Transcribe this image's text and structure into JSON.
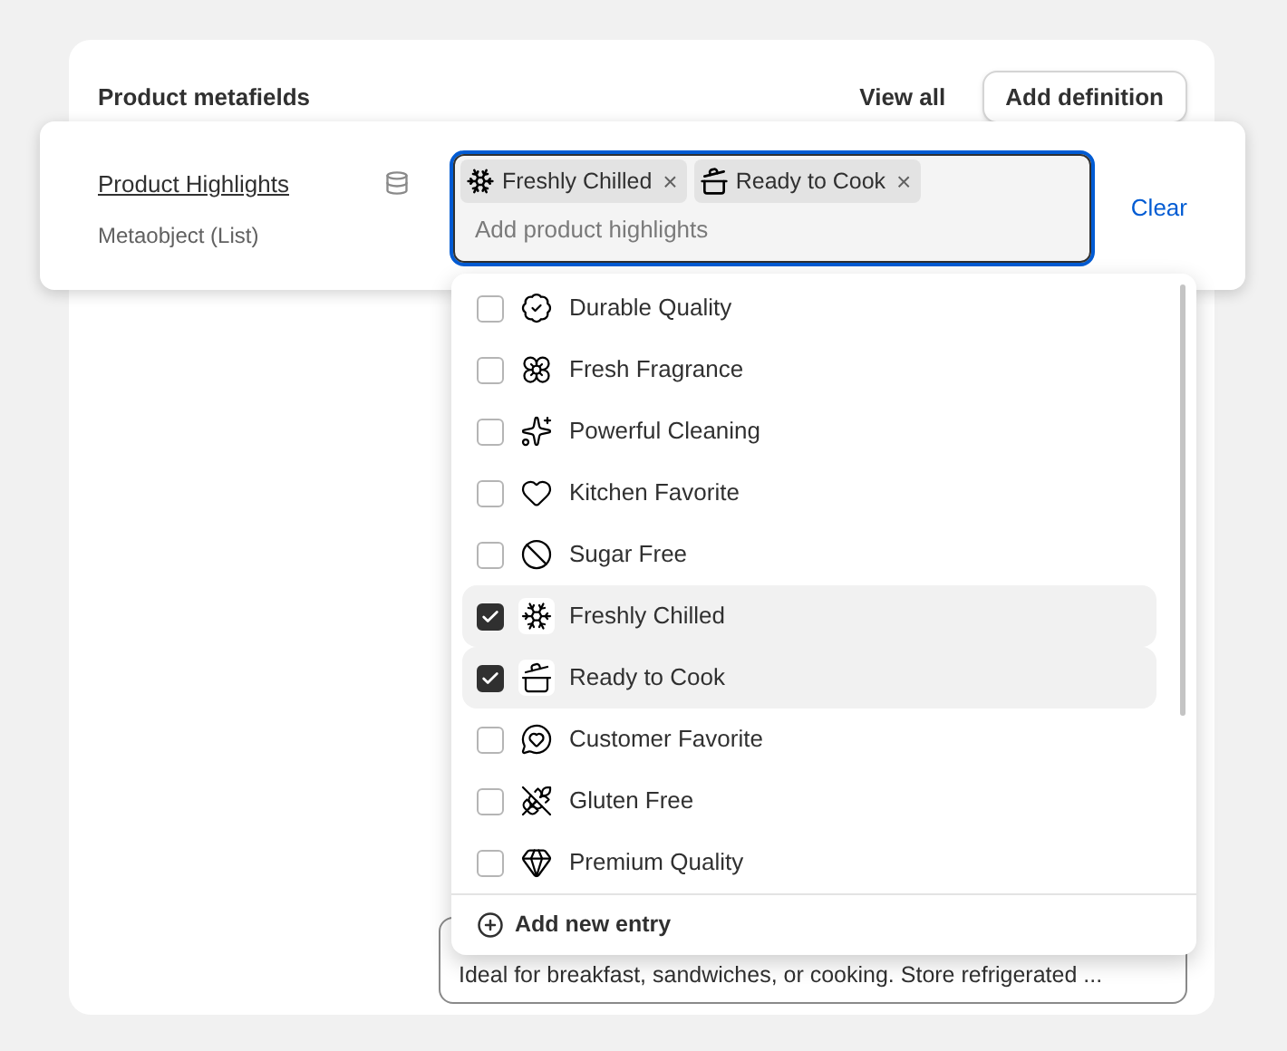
{
  "card": {
    "title": "Product metafields",
    "view_all": "View all",
    "add_definition": "Add definition"
  },
  "field": {
    "name": "Product Highlights",
    "type": "Metaobject (List)",
    "placeholder": "Add product highlights",
    "clear": "Clear",
    "tags": [
      {
        "label": "Freshly Chilled",
        "remove": "×"
      },
      {
        "label": "Ready to Cook",
        "remove": "×"
      }
    ]
  },
  "options": [
    {
      "label": "Durable Quality",
      "checked": false
    },
    {
      "label": "Fresh Fragrance",
      "checked": false
    },
    {
      "label": "Powerful Cleaning",
      "checked": false
    },
    {
      "label": "Kitchen Favorite",
      "checked": false
    },
    {
      "label": "Sugar Free",
      "checked": false
    },
    {
      "label": "Freshly Chilled",
      "checked": true
    },
    {
      "label": "Ready to Cook",
      "checked": true
    },
    {
      "label": "Customer Favorite",
      "checked": false
    },
    {
      "label": "Gluten Free",
      "checked": false
    },
    {
      "label": "Premium Quality",
      "checked": false
    }
  ],
  "add_entry": "Add new entry",
  "description_value": "Ideal for breakfast, sandwiches, or cooking. Store refrigerated ..."
}
